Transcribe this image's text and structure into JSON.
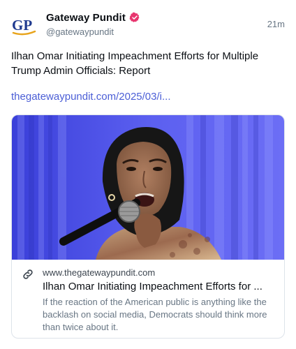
{
  "post": {
    "author": {
      "display_name": "Gateway Pundit",
      "handle": "@gatewaypundit",
      "avatar_text": "GP",
      "avatar_icon": "gateway-pundit-logo",
      "verified_icon": "verified-badge-icon"
    },
    "timestamp": "21m",
    "text": "Ilhan Omar Initiating Impeachment Efforts for Multiple Trump Admin Officials: Report",
    "link_text": "thegatewaypundit.com/2025/03/i...",
    "card": {
      "image_icon": "article-photo",
      "link_icon": "link-icon",
      "domain": "www.thegatewaypundit.com",
      "title": "Ilhan Omar Initiating Impeachment Efforts for ...",
      "description": "If the reaction of the American public is anything like the backlash on social media, Democrats should think more than twice about it."
    }
  },
  "colors": {
    "link": "#4b5ed6",
    "verified": "#e8366f",
    "logo_blue": "#1f3a8f",
    "logo_gold": "#e8a41c",
    "muted_text": "#687684",
    "card_border": "#dde3ea"
  }
}
